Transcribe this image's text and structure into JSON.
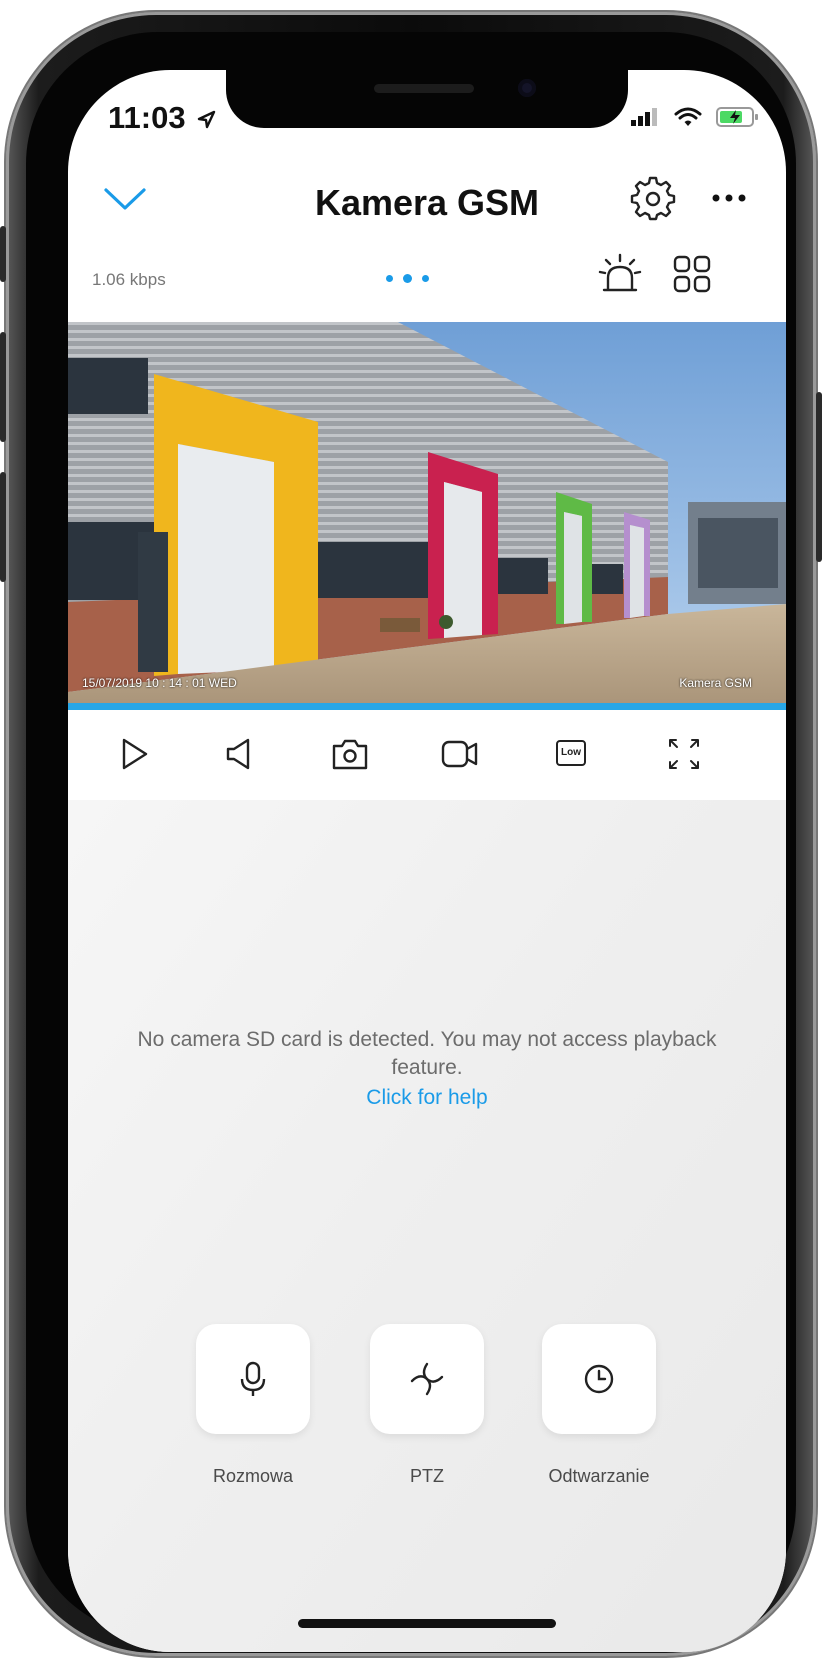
{
  "status_bar": {
    "time": "11:03"
  },
  "nav": {
    "title": "Kamera GSM"
  },
  "sub_header": {
    "bitrate": "1.06 kbps"
  },
  "video": {
    "timestamp": "15/07/2019 10 : 14 : 01 WED",
    "camera_label": "Kamera GSM"
  },
  "controls": {
    "quality_label": "Low"
  },
  "content": {
    "sd_message": "No camera SD card is detected. You may not access playback feature.",
    "help_link": "Click for help"
  },
  "quick_actions": [
    {
      "label": "Rozmowa",
      "icon": "microphone-icon"
    },
    {
      "label": "PTZ",
      "icon": "ptz-icon"
    },
    {
      "label": "Odtwarzanie",
      "icon": "clock-icon"
    }
  ],
  "colors": {
    "accent": "#1a9be8",
    "progress": "#27a6e6"
  }
}
